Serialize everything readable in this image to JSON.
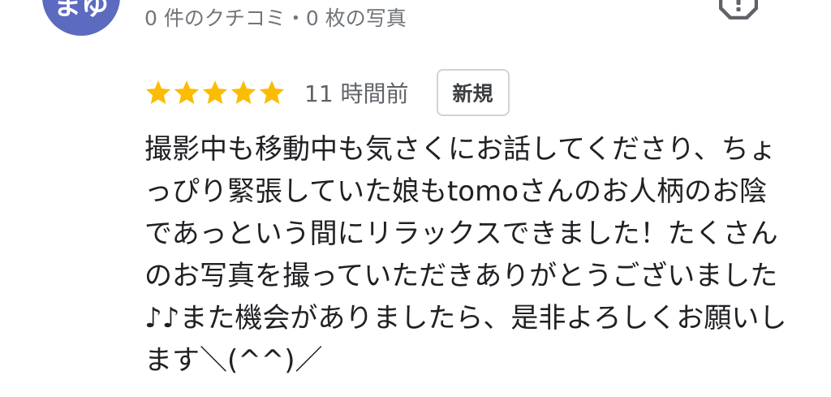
{
  "reviewer": {
    "avatar_text": "まゆ",
    "avatar_color": "#5c6bc0",
    "meta": "0 件のクチコミ・0 枚の写真"
  },
  "report_icon": "report-flag-icon",
  "review": {
    "rating": 5,
    "max_rating": 5,
    "star_color": "#fbbc04",
    "time": "11 時間前",
    "badge": "新規",
    "text": "撮影中も移動中も気さくにお話してくださり、ちょっぴり緊張していた娘もtomoさんのお人柄のお陰であっという間にリラックスできました！たくさんのお写真を撮っていただきありがとうございました♪♪また機会がありましたら、是非よろしくお願いします＼(^^)／"
  }
}
